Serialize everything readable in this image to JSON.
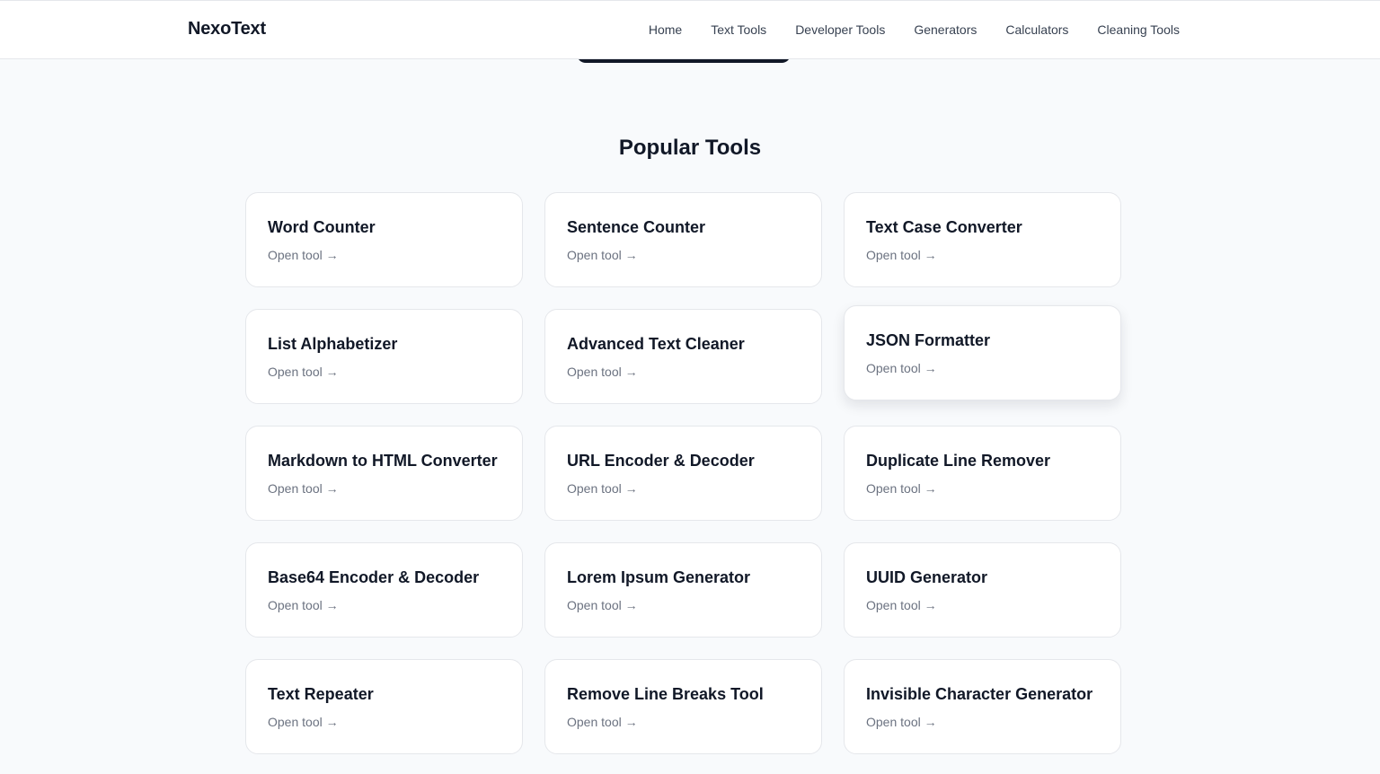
{
  "header": {
    "brand": "NexoText",
    "nav": [
      "Home",
      "Text Tools",
      "Developer Tools",
      "Generators",
      "Calculators",
      "Cleaning Tools"
    ]
  },
  "section": {
    "title": "Popular Tools"
  },
  "tools": [
    {
      "title": "Word Counter",
      "link": "Open tool →"
    },
    {
      "title": "Sentence Counter",
      "link": "Open tool →"
    },
    {
      "title": "Text Case Converter",
      "link": "Open tool →"
    },
    {
      "title": "List Alphabetizer",
      "link": "Open tool →"
    },
    {
      "title": "Advanced Text Cleaner",
      "link": "Open tool →"
    },
    {
      "title": "JSON Formatter",
      "link": "Open tool →"
    },
    {
      "title": "Markdown to HTML Converter",
      "link": "Open tool →"
    },
    {
      "title": "URL Encoder & Decoder",
      "link": "Open tool →"
    },
    {
      "title": "Duplicate Line Remover",
      "link": "Open tool →"
    },
    {
      "title": "Base64 Encoder & Decoder",
      "link": "Open tool →"
    },
    {
      "title": "Lorem Ipsum Generator",
      "link": "Open tool →"
    },
    {
      "title": "UUID Generator",
      "link": "Open tool →"
    },
    {
      "title": "Text Repeater",
      "link": "Open tool →"
    },
    {
      "title": "Remove Line Breaks Tool",
      "link": "Open tool →"
    },
    {
      "title": "Invisible Character Generator",
      "link": "Open tool →"
    }
  ]
}
